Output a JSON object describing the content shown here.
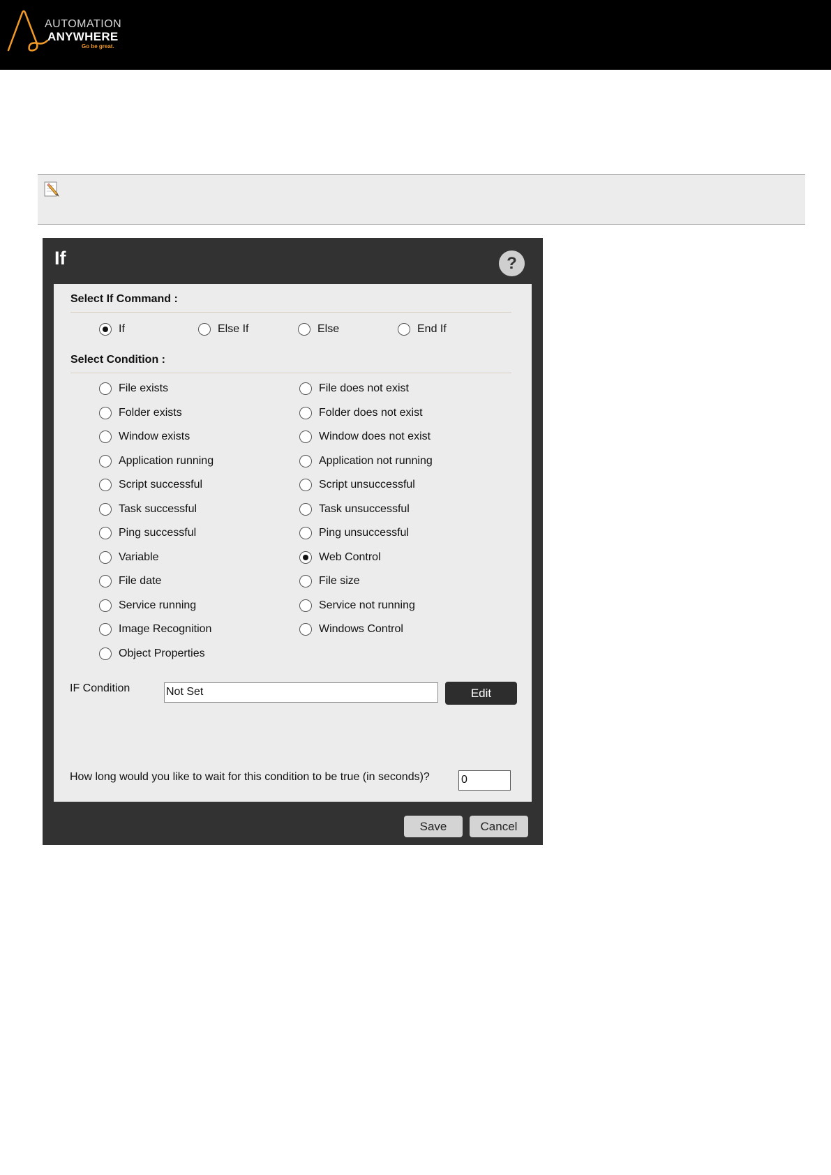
{
  "header": {
    "logo": {
      "line1": "AUTOMATION",
      "line2": "ANYWHERE",
      "tagline": "Go be great."
    }
  },
  "note": {
    "icon": "pencil-note-icon"
  },
  "dialog": {
    "title": "If",
    "help_label": "?",
    "command_section_title": "Select If Command :",
    "commands": [
      {
        "label": "If",
        "selected": true
      },
      {
        "label": "Else If",
        "selected": false
      },
      {
        "label": "Else",
        "selected": false
      },
      {
        "label": "End If",
        "selected": false
      }
    ],
    "condition_section_title": "Select Condition :",
    "conditions_left": [
      {
        "label": "File exists",
        "selected": false
      },
      {
        "label": "Folder exists",
        "selected": false
      },
      {
        "label": "Window exists",
        "selected": false
      },
      {
        "label": "Application running",
        "selected": false
      },
      {
        "label": "Script successful",
        "selected": false
      },
      {
        "label": "Task successful",
        "selected": false
      },
      {
        "label": "Ping successful",
        "selected": false
      },
      {
        "label": "Variable",
        "selected": false
      },
      {
        "label": "File date",
        "selected": false
      },
      {
        "label": "Service running",
        "selected": false
      },
      {
        "label": "Image Recognition",
        "selected": false
      },
      {
        "label": "Object Properties",
        "selected": false
      }
    ],
    "conditions_right": [
      {
        "label": "File does not exist",
        "selected": false
      },
      {
        "label": "Folder does not exist",
        "selected": false
      },
      {
        "label": "Window does not exist",
        "selected": false
      },
      {
        "label": "Application not running",
        "selected": false
      },
      {
        "label": "Script unsuccessful",
        "selected": false
      },
      {
        "label": "Task unsuccessful",
        "selected": false
      },
      {
        "label": "Ping unsuccessful",
        "selected": false
      },
      {
        "label": "Web Control",
        "selected": true
      },
      {
        "label": "File size",
        "selected": false
      },
      {
        "label": "Service not running",
        "selected": false
      },
      {
        "label": "Windows Control",
        "selected": false
      }
    ],
    "if_condition_label": "IF Condition",
    "if_condition_value": "Not Set",
    "edit_label": "Edit",
    "wait_label": "How long would you like to wait for this condition to be true (in seconds)?",
    "wait_value": "0",
    "save_label": "Save",
    "cancel_label": "Cancel"
  },
  "colors": {
    "header_bg": "#000000",
    "logo_accent": "#f29a28",
    "dialog_bg": "#323232",
    "panel_bg": "#ececec"
  }
}
